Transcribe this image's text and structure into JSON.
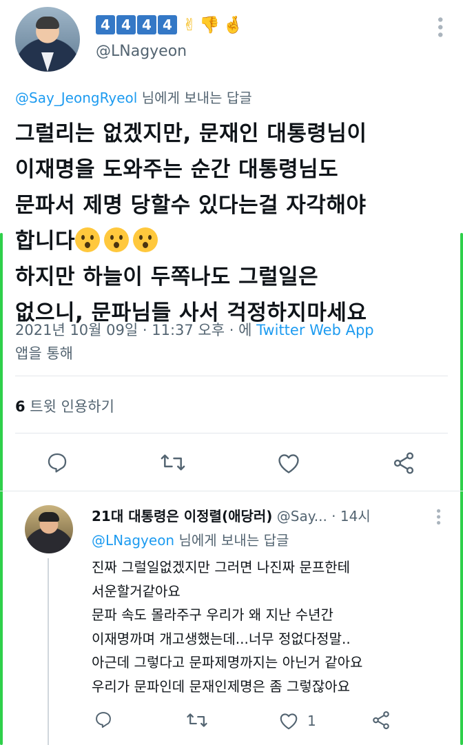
{
  "main_tweet": {
    "badges": [
      "4",
      "4",
      "4",
      "4"
    ],
    "handle": "@LNagyeon",
    "reply_to_handle": "@Say_JeongRyeol",
    "reply_to_suffix": " 님에게 보내는 답글",
    "body_lines": [
      "그럴리는 없겠지만, 문재인 대통령님이",
      "이재명을 도와주는 순간 대통령님도",
      "문파서 제명 당할수 있다는걸 자각해야",
      "합니다",
      "하지만 하늘이 두쪽나도 그럴일은",
      "없으니, 문파님들 사서 걱정하지마세요"
    ],
    "timestamp": "2021년 10월 09일 · 11:37 오후 · 에 ",
    "source": "Twitter Web App",
    "source_suffix": "앱을 통해",
    "quote_count": "6",
    "quote_label": " 트윗 인용하기",
    "icons": [
      "reply-icon",
      "retweet-icon",
      "like-icon",
      "share-icon"
    ]
  },
  "reply_tweet": {
    "display_name": "21대 대통령은 이정렬(애당러)",
    "handle_truncated": " @Say...",
    "time": " · 14시",
    "reply_to_handle": "@LNagyeon",
    "reply_to_suffix": " 님에게 보내는 답글",
    "body": "진짜 그럴일없겠지만 그러면 나진짜 문프한테\n서운할거같아요\n문파 속도 몰라주구 우리가 왜 지난 수년간\n이재명까며 개고생했는데...너무 정없다정말..\n아근데 그렇다고 문파제명까지는 아닌거 같아요\n우리가 문파인데 문재인제명은 좀 그렇잖아요",
    "like_count": "1"
  },
  "colors": {
    "accent": "#1d9bf0",
    "badge_blue": "#3478c6",
    "secondary_text": "#536471",
    "indicator_green": "#2fd04a"
  }
}
